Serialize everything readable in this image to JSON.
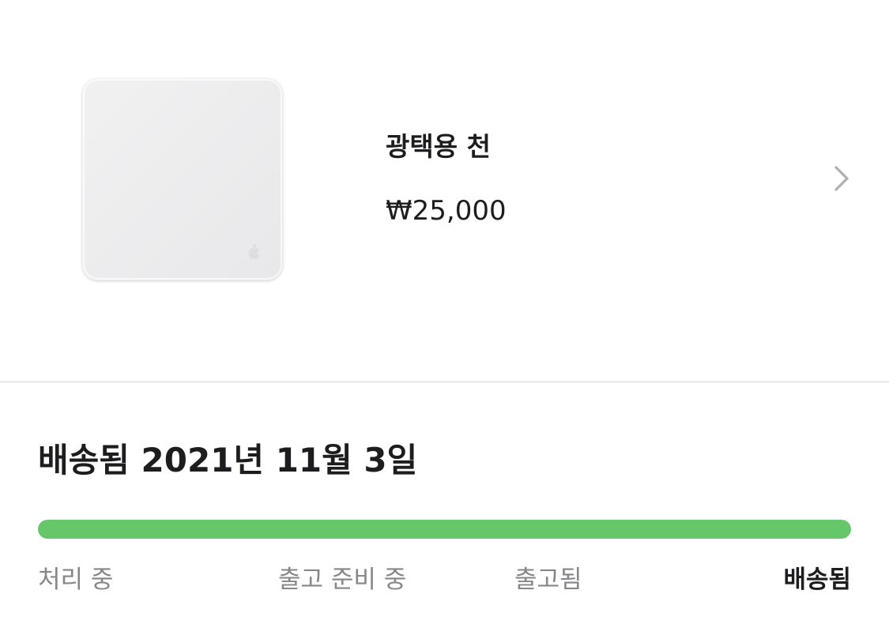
{
  "product": {
    "name": "광택용 천",
    "price": "₩25,000",
    "image_icon": "polishing-cloth-image",
    "chevron_icon": "chevron-right-icon"
  },
  "shipment": {
    "title": "배송됨 2021년 11월 3일",
    "progress": 1.0,
    "progress_color": "#66c66a",
    "steps": [
      {
        "label": "처리 중",
        "active": false
      },
      {
        "label": "출고 준비 중",
        "active": false
      },
      {
        "label": "출고됨",
        "active": false
      },
      {
        "label": "배송됨",
        "active": true
      }
    ]
  }
}
